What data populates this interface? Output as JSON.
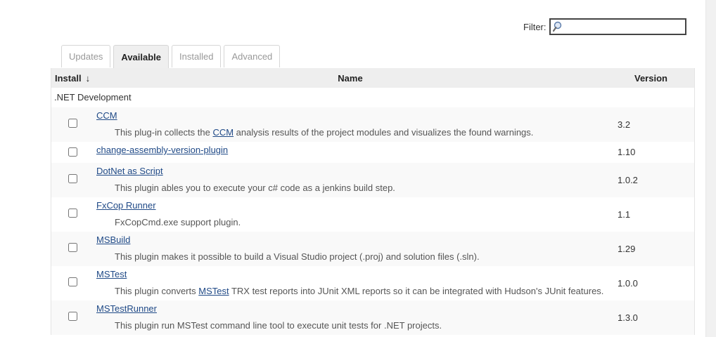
{
  "filter": {
    "label": "Filter:",
    "value": "",
    "icon": "magnifier-icon"
  },
  "tabs": [
    {
      "label": "Updates",
      "active": false
    },
    {
      "label": "Available",
      "active": true
    },
    {
      "label": "Installed",
      "active": false
    },
    {
      "label": "Advanced",
      "active": false
    }
  ],
  "table": {
    "headers": {
      "install": "Install",
      "sort_arrow": "↓",
      "name": "Name",
      "version": "Version"
    },
    "category": ".NET Development",
    "plugins": [
      {
        "name": "CCM",
        "desc_before": "This plug-in collects the ",
        "desc_link": "CCM",
        "desc_after": " analysis results of the project modules and visualizes the found warnings.",
        "version": "3.2"
      },
      {
        "name": "change-assembly-version-plugin",
        "version": "1.10"
      },
      {
        "name": "DotNet as Script",
        "desc_before": "This plugin ables you to execute your c# code as a jenkins build step.",
        "version": "1.0.2"
      },
      {
        "name": "FxCop Runner",
        "desc_before": "FxCopCmd.exe support plugin.",
        "version": "1.1"
      },
      {
        "name": "MSBuild",
        "desc_before": "This plugin makes it possible to build a Visual Studio project (.proj) and solution files (.sln).",
        "version": "1.29"
      },
      {
        "name": "MSTest",
        "desc_before": "This plugin converts ",
        "desc_link": "MSTest",
        "desc_after": " TRX test reports into JUnit XML reports so it can be integrated with Hudson's JUnit features.",
        "version": "1.0.0"
      },
      {
        "name": "MSTestRunner",
        "desc_before": "This plugin run MSTest command line tool to execute unit tests for .NET projects.",
        "version": "1.3.0"
      }
    ]
  }
}
